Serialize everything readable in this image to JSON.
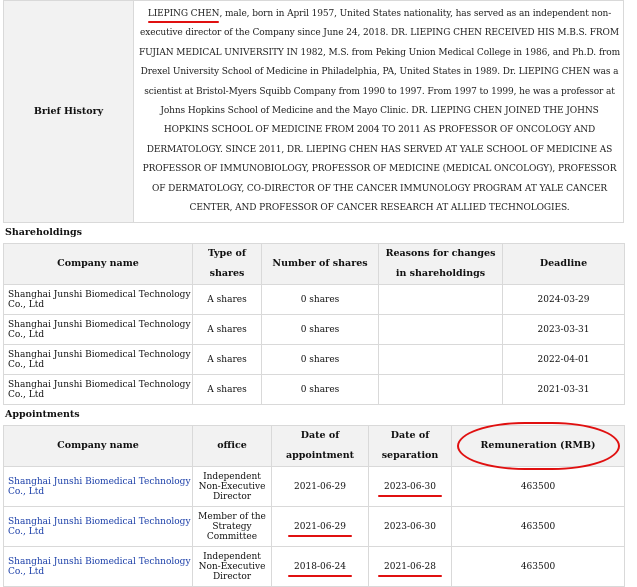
{
  "brief_history": {
    "label": "Brief History",
    "name": "LIEPING CHEN",
    "text_rest": ", male, born in April 1957, United States nationality, has served as an independent non-executive director of the Company since June 24, 2018. DR. LIEPING CHEN RECEIVED HIS M.B.S. FROM FUJIAN MEDICAL UNIVERSITY IN 1982, M.S. from Peking Union Medical College in 1986, and Ph.D. from Drexel University School of Medicine in Philadelphia, PA, United States in 1989. Dr. LIEPING CHEN was a scientist at Bristol-Myers Squibb Company from 1990 to 1997. From 1997 to 1999, he was a professor at Johns Hopkins School of Medicine and the Mayo Clinic. DR. LIEPING CHEN JOINED THE JOHNS HOPKINS SCHOOL OF MEDICINE FROM 2004 TO 2011 AS PROFESSOR OF ONCOLOGY AND DERMATOLOGY. SINCE 2011, DR. LIEPING CHEN HAS SERVED AT YALE SCHOOL OF MEDICINE AS PROFESSOR OF IMMUNOBIOLOGY, PROFESSOR OF MEDICINE (MEDICAL ONCOLOGY), PROFESSOR OF DERMATOLOGY, CO-DIRECTOR OF THE CANCER IMMUNOLOGY PROGRAM AT YALE CANCER CENTER, AND PROFESSOR OF CANCER RESEARCH AT ALLIED TECHNOLOGIES."
  },
  "shareholdings": {
    "title": "Shareholdings",
    "headers": [
      "Company name",
      "Type of shares",
      "Number of shares",
      "Reasons for changes in shareholdings",
      "Deadline"
    ],
    "rows": [
      {
        "company": "Shanghai Junshi Biomedical Technology Co., Ltd",
        "type": "A shares",
        "number": "0 shares",
        "reason": "",
        "deadline": "2024-03-29"
      },
      {
        "company": "Shanghai Junshi Biomedical Technology Co., Ltd",
        "type": "A shares",
        "number": "0 shares",
        "reason": "",
        "deadline": "2023-03-31"
      },
      {
        "company": "Shanghai Junshi Biomedical Technology Co., Ltd",
        "type": "A shares",
        "number": "0 shares",
        "reason": "",
        "deadline": "2022-04-01"
      },
      {
        "company": "Shanghai Junshi Biomedical Technology Co., Ltd",
        "type": "A shares",
        "number": "0 shares",
        "reason": "",
        "deadline": "2021-03-31"
      }
    ]
  },
  "appointments": {
    "title": "Appointments",
    "headers": [
      "Company name",
      "office",
      "Date of appointment",
      "Date of separation",
      "Remuneration (RMB)"
    ],
    "rows": [
      {
        "company": "Shanghai Junshi Biomedical Technology Co., Ltd",
        "office": "Independent Non-Executive Director",
        "appointed": "2021-06-29",
        "separated": "2023-06-30",
        "remuneration": "463500"
      },
      {
        "company": "Shanghai Junshi Biomedical Technology Co., Ltd",
        "office": "Member of the Strategy Committee",
        "appointed": "2021-06-29",
        "separated": "2023-06-30",
        "remuneration": "463500"
      },
      {
        "company": "Shanghai Junshi Biomedical Technology Co., Ltd",
        "office": "Independent Non-Executive Director",
        "appointed": "2018-06-24",
        "separated": "2021-06-28",
        "remuneration": "463500"
      }
    ]
  }
}
